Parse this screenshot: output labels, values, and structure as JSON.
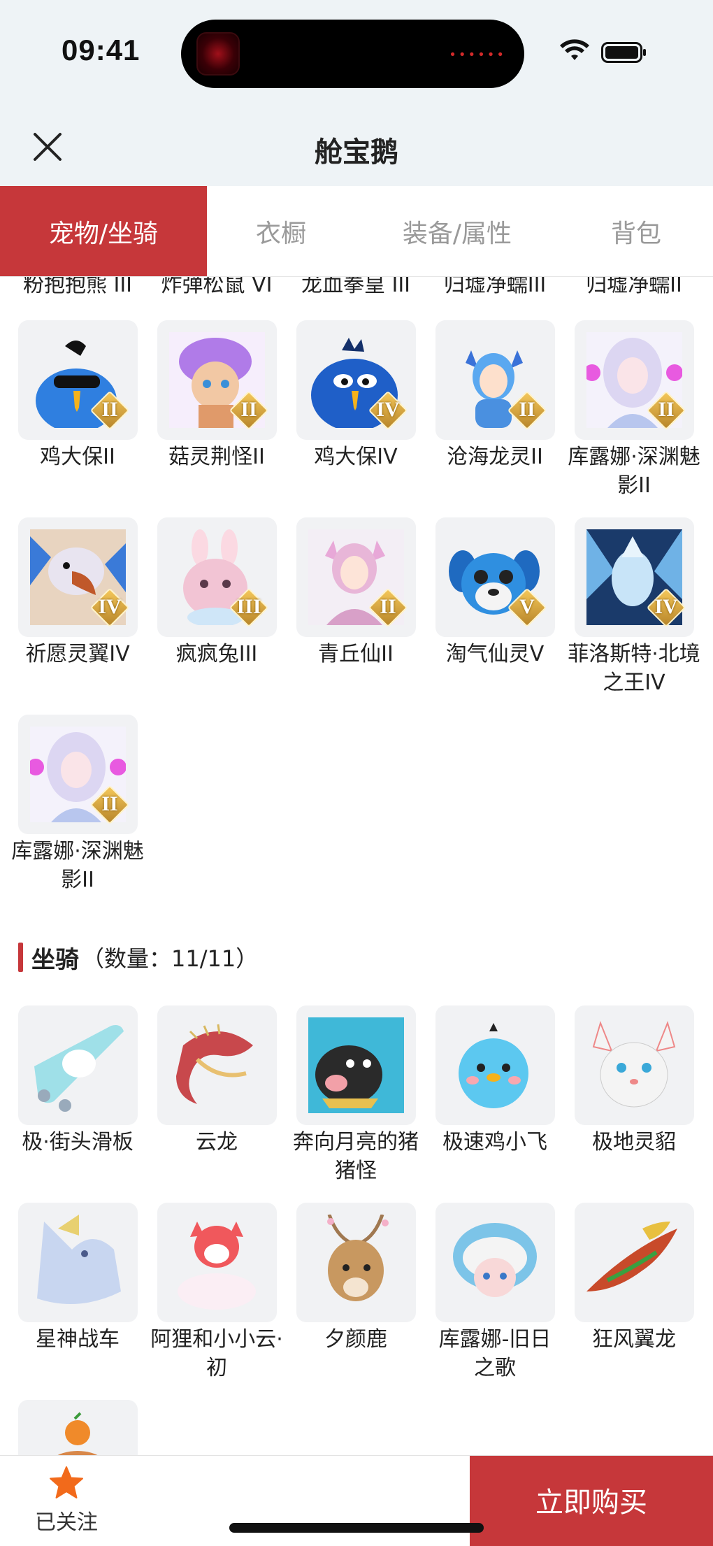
{
  "status_bar": {
    "time": "09:41"
  },
  "header": {
    "title": "舱宝鹅"
  },
  "tabs": [
    {
      "label": "宠物/坐骑",
      "active": true
    },
    {
      "label": "衣橱",
      "active": false
    },
    {
      "label": "装备/属性",
      "active": false
    },
    {
      "label": "背包",
      "active": false
    }
  ],
  "partial_row": [
    "粉抱抱熊 III",
    "炸弹松鼠 VI",
    "龙血拳皇 III",
    "归墟净蠕III",
    "归墟净蠕II"
  ],
  "pets": [
    {
      "name": "鸡大保II",
      "grade": "II",
      "art": "bird-black",
      "color": "#2f7fe0"
    },
    {
      "name": "菇灵荆怪II",
      "grade": "II",
      "art": "mushroom",
      "color": "#b07be8"
    },
    {
      "name": "鸡大保IV",
      "grade": "IV",
      "art": "bird-blue",
      "color": "#1f5fc8"
    },
    {
      "name": "沧海龙灵II",
      "grade": "II",
      "art": "dragon-girl",
      "color": "#5aa8f0"
    },
    {
      "name": "库露娜·深渊魅影II",
      "grade": "II",
      "art": "luna",
      "color": "#dcd6f2"
    },
    {
      "name": "祈愿灵翼IV",
      "grade": "IV",
      "art": "griffin",
      "color": "#c0582a"
    },
    {
      "name": "疯疯兔III",
      "grade": "III",
      "art": "bunny",
      "color": "#f2c4d4"
    },
    {
      "name": "青丘仙II",
      "grade": "II",
      "art": "fox-girl",
      "color": "#e8b6d8"
    },
    {
      "name": "淘气仙灵V",
      "grade": "V",
      "art": "puppy",
      "color": "#2f8fe0"
    },
    {
      "name": "菲洛斯特·北境之王IV",
      "grade": "IV",
      "art": "ice-king",
      "color": "#6fb2e6"
    },
    {
      "name": "库露娜·深渊魅影II",
      "grade": "II",
      "art": "luna",
      "color": "#dcd6f2"
    }
  ],
  "mount_section": {
    "title": "坐骑",
    "count": "（数量：11/11）"
  },
  "mounts": [
    {
      "name": "极·街头滑板",
      "art": "skateboard",
      "color": "#9fe0e8"
    },
    {
      "name": "云龙",
      "art": "cloud-dragon",
      "color": "#c8484c"
    },
    {
      "name": "奔向月亮的猪猪怪",
      "art": "pig",
      "color": "#3fb8d8"
    },
    {
      "name": "极速鸡小飞",
      "art": "chick",
      "color": "#5cc8f0"
    },
    {
      "name": "极地灵貂",
      "art": "ferret",
      "color": "#f4f4f4"
    },
    {
      "name": "星神战车",
      "art": "unicorn",
      "color": "#c8d6f0"
    },
    {
      "name": "阿狸和小小云·初",
      "art": "ali",
      "color": "#f0585c"
    },
    {
      "name": "夕颜鹿",
      "art": "deer",
      "color": "#c89860"
    },
    {
      "name": "库露娜-旧日之歌",
      "art": "sheep-girl",
      "color": "#7cc4e8"
    },
    {
      "name": "狂风翼龙",
      "art": "wyvern",
      "color": "#c84a2a"
    },
    {
      "name": "",
      "art": "orange-mount",
      "color": "#f08a2a"
    }
  ],
  "bottom_bar": {
    "follow_label": "已关注",
    "buy_label": "立即购买"
  },
  "colors": {
    "accent": "#c6373a",
    "thumb_bg": "#f1f2f4"
  }
}
